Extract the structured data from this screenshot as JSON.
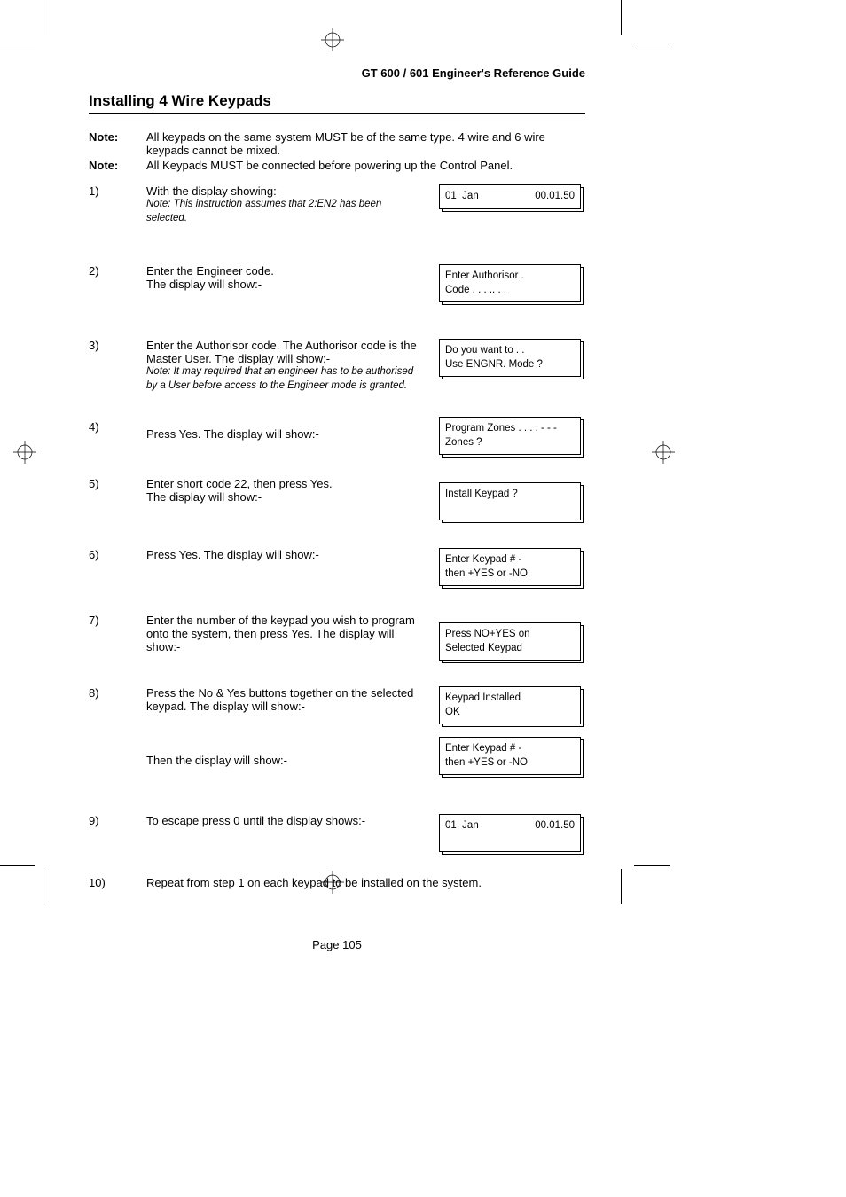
{
  "header": {
    "running_head": "GT 600 / 601 Engineer's Reference Guide",
    "section_title": "Installing 4 Wire Keypads"
  },
  "notes": [
    {
      "label": "Note:",
      "text": "All keypads on the same system MUST be of the same type. 4 wire and 6 wire keypads cannot be mixed."
    },
    {
      "label": "Note:",
      "text": "All Keypads MUST be connected before powering up the Control Panel."
    }
  ],
  "steps": [
    {
      "num": "1)",
      "body": "With the display showing:-",
      "note": "Note: This instruction assumes that 2:EN2 has been selected.",
      "displays": [
        {
          "l1a": "01  Jan",
          "l1b": "00.01.50",
          "l2": ""
        }
      ]
    },
    {
      "num": "2)",
      "body": "Enter the Engineer code.\nThe display will show:-",
      "displays": [
        {
          "l1": "Enter  Authorisor .",
          "l2": "Code . . . .. . ."
        }
      ]
    },
    {
      "num": "3)",
      "body": "Enter the Authorisor code. The Authorisor code is the Master User. The display will show:-",
      "note": "Note: It may required that an engineer has to be authorised by a User before access to the Engineer mode is granted.",
      "displays": [
        {
          "l1": "Do you want to . .",
          "l2": "Use ENGNR. Mode ?"
        }
      ]
    },
    {
      "num": "4)",
      "body": "Press Yes. The display will show:-",
      "displays": [
        {
          "l1": "Program Zones . . . . - - -",
          "l2": "Zones ?"
        }
      ]
    },
    {
      "num": "5)",
      "body": "Enter short code 22, then press Yes.\nThe display will show:-",
      "displays": [
        {
          "l1": "Install  Keypad  ?",
          "l2": ""
        }
      ]
    },
    {
      "num": "6)",
      "body": "Press Yes. The display will show:-",
      "displays": [
        {
          "l1": "Enter Keypad  #     -",
          "l2": "then  +YES  or  -NO"
        }
      ]
    },
    {
      "num": "7)",
      "body": "Enter the number of the keypad you wish to program onto the system, then press Yes. The display will show:-",
      "displays": [
        {
          "l1": "Press NO+YES on",
          "l2": "Selected  Keypad"
        }
      ]
    },
    {
      "num": "8)",
      "body": "Press the No & Yes buttons together on the selected keypad. The display will show:-",
      "after_body": "Then the display will show:-",
      "displays": [
        {
          "l1": "Keypad Installed",
          "l2": "OK"
        },
        {
          "l1": "Enter Keypad  #     -",
          "l2": "then  +YES  or  -NO"
        }
      ]
    },
    {
      "num": "9)",
      "body": "To escape press 0 until the display shows:-",
      "displays": [
        {
          "l1a": "01  Jan",
          "l1b": "00.01.50",
          "l2": ""
        }
      ]
    },
    {
      "num": "10)",
      "body": "Repeat from step 1 on each keypad to be installed on the system.",
      "displays": []
    }
  ],
  "footer": {
    "page_label": "Page  105"
  }
}
